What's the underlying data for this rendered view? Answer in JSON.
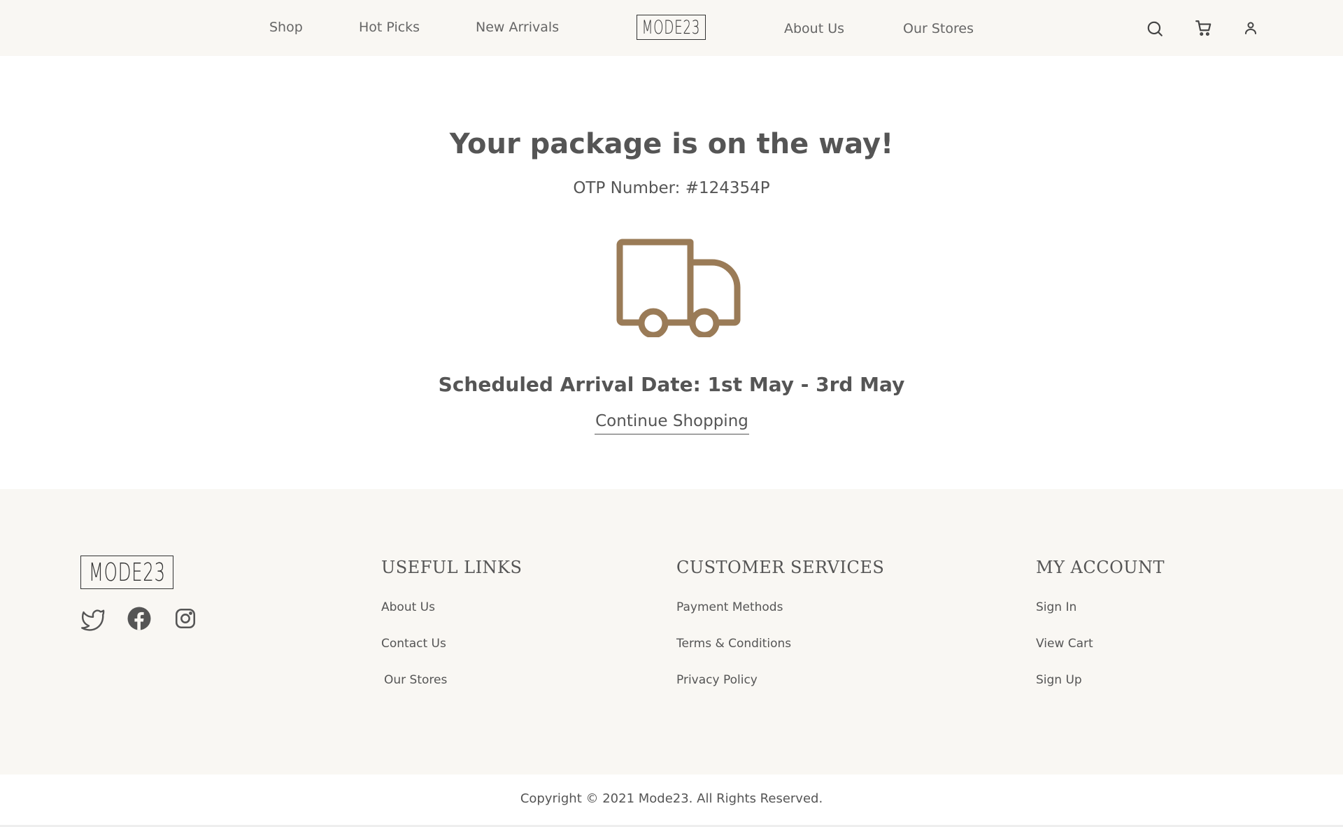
{
  "header": {
    "nav_left": [
      "Shop",
      "Hot Picks",
      "New Arrivals"
    ],
    "logo": "MODE23",
    "nav_right": [
      "About Us",
      "Our Stores"
    ],
    "icons": [
      "search-icon",
      "cart-icon",
      "user-icon"
    ]
  },
  "main": {
    "title": "Your package is on the way!",
    "otp": "OTP Number: #124354P",
    "arrival": "Scheduled Arrival Date: 1st May - 3rd May",
    "continue_label": "Continue Shopping",
    "truck_icon": "truck-icon"
  },
  "footer": {
    "logo": "MODE23",
    "social": [
      "twitter-icon",
      "facebook-icon",
      "instagram-icon"
    ],
    "useful_links": {
      "heading": "USEFUL LINKS",
      "items": [
        "About Us",
        "Contact Us",
        "Our Stores"
      ]
    },
    "customer_services": {
      "heading": "CUSTOMER SERVICES",
      "items": [
        "Payment Methods",
        "Terms & Conditions",
        "Privacy Policy"
      ]
    },
    "my_account": {
      "heading": "MY ACCOUNT",
      "items": [
        "Sign In",
        "View Cart",
        "Sign Up"
      ]
    },
    "copyright": "Copyright © 2021 Mode23. All Rights Reserved."
  },
  "colors": {
    "accent": "#9a7b57",
    "header_bg": "#f9f7f3",
    "text": "#555555"
  }
}
